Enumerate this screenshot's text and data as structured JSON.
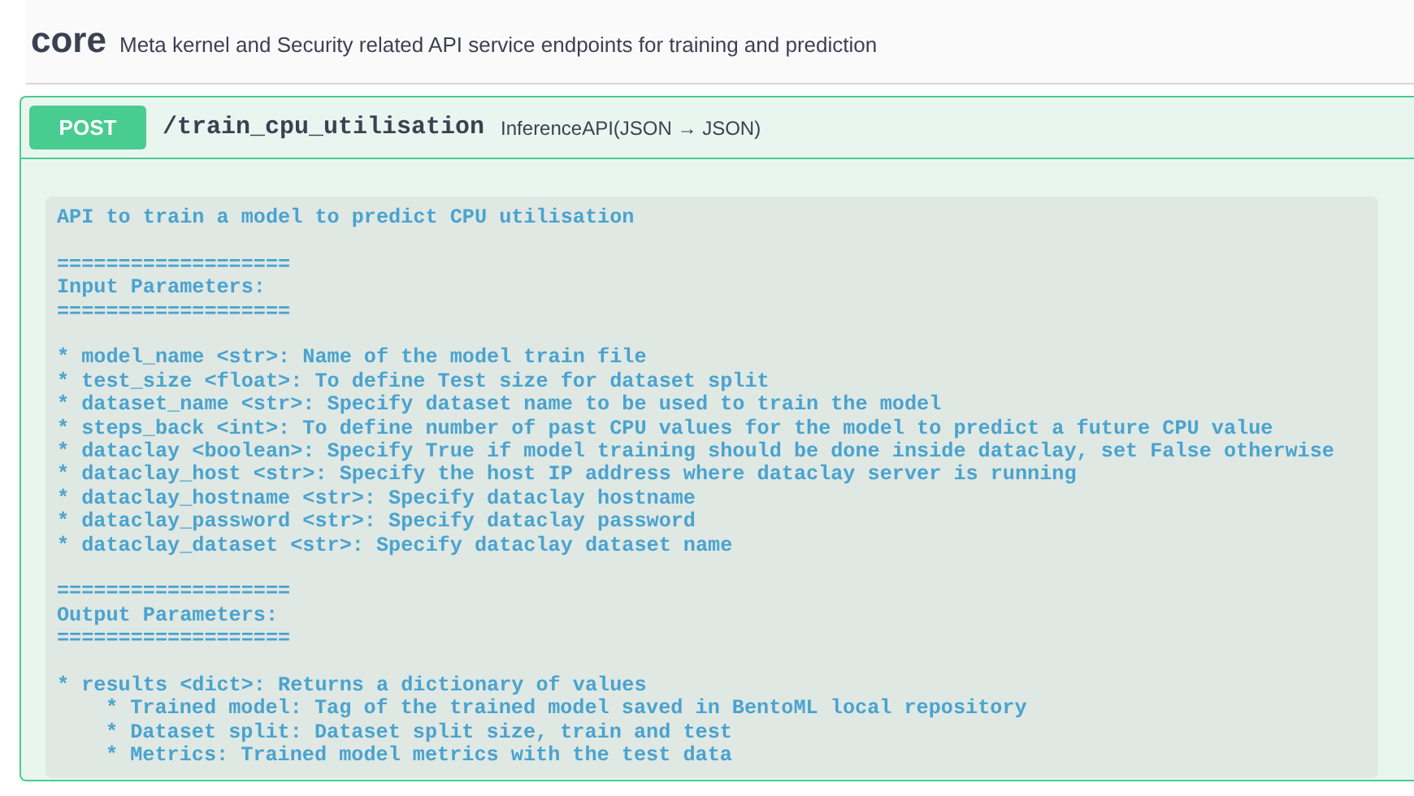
{
  "tag": {
    "name": "core",
    "description": "Meta kernel and Security related API service endpoints for training and prediction"
  },
  "operation": {
    "method": "POST",
    "path": "/train_cpu_utilisation",
    "summary": "InferenceAPI(JSON → JSON)",
    "doc_sections": [
      {
        "lines": [
          {
            "text": "API to train a model to predict CPU utilisation"
          }
        ]
      },
      {
        "lines": [
          {
            "text": "==================="
          },
          {
            "text": "Input Parameters:"
          },
          {
            "text": "==================="
          }
        ]
      },
      {
        "lines": [
          {
            "text": "* model_name <str>: Name of the model train file"
          },
          {
            "text": "* test_size <float>: To define Test size for dataset split"
          },
          {
            "text": "* dataset_name <str>: Specify dataset name to be used to train the model"
          },
          {
            "text": "* steps_back <int>: To define number of past CPU values for the model to predict a future CPU value"
          },
          {
            "text": "* dataclay <boolean>: Specify True if model training should be done inside dataclay, set False otherwise"
          },
          {
            "text": "* dataclay_host <str>: Specify the host IP address where dataclay server is running"
          },
          {
            "text": "* dataclay_hostname <str>: Specify dataclay hostname"
          },
          {
            "text": "* dataclay_password <str>: Specify dataclay password"
          },
          {
            "text": "* dataclay_dataset <str>: Specify dataclay dataset name"
          }
        ]
      },
      {
        "lines": [
          {
            "text": "==================="
          },
          {
            "text": "Output Parameters:"
          },
          {
            "text": "==================="
          }
        ]
      },
      {
        "lines": [
          {
            "text": "* results <dict>: Returns a dictionary of values",
            "children": [
              {
                "text": "* Trained model: Tag of the trained model saved in BentoML local repository"
              },
              {
                "text": "* Dataset split: Dataset split size, train and test"
              },
              {
                "text": "* Metrics: Trained model metrics with the test data"
              }
            ]
          }
        ]
      }
    ]
  }
}
